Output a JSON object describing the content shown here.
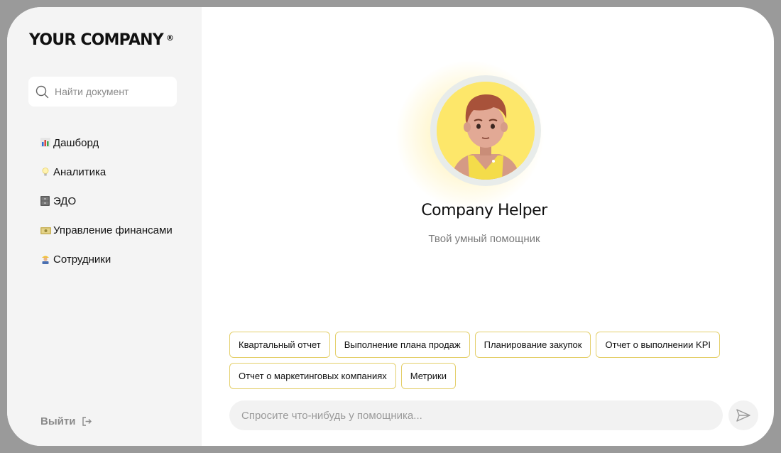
{
  "brand": {
    "name": "YOUR COMPANY",
    "mark": "®"
  },
  "search": {
    "placeholder": "Найти документ",
    "icon": "search-icon"
  },
  "sidebar": {
    "items": [
      {
        "label": "Дашборд",
        "icon": "bar-chart-icon"
      },
      {
        "label": "Аналитика",
        "icon": "lightbulb-icon"
      },
      {
        "label": "ЭДО",
        "icon": "cabinet-icon"
      },
      {
        "label": "Управление финансами",
        "icon": "money-icon"
      },
      {
        "label": "Сотрудники",
        "icon": "worker-icon"
      }
    ],
    "logout_label": "Выйти"
  },
  "assistant": {
    "name": "Company Helper",
    "tagline": "Твой умный помощник"
  },
  "chips": [
    [
      "Квартальный отчет",
      "Выполнение плана продаж",
      "Планирование закупок",
      "Отчет о выполнении KPI"
    ],
    [
      "Отчет о маркетинговых компаниях",
      "Метрики"
    ]
  ],
  "chat": {
    "placeholder": "Спросите что-нибудь у помощника...",
    "send_icon": "send-icon"
  },
  "colors": {
    "accent": "#fde76a",
    "chip_border": "#e4cf6b",
    "sidebar_bg": "#f4f4f4"
  }
}
